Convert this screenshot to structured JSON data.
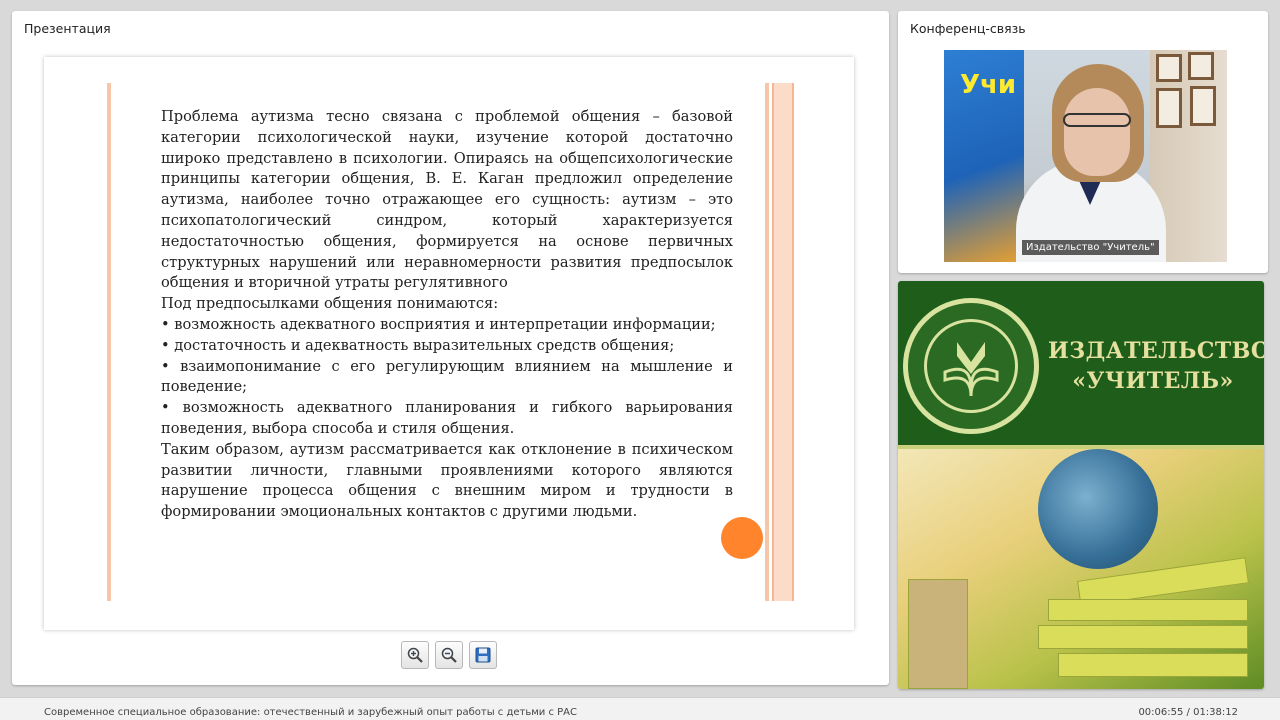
{
  "presentation": {
    "title": "Презентация",
    "slide": {
      "paragraphs": [
        "Проблема аутизма тесно связана с проблемой общения – базовой категории психологической науки, изучение которой достаточно широко представлено в психологии. Опираясь на общепсихологические принципы категории общения, В. Е. Каган предложил определение аутизма, наиболее точно отражающее его сущность: аутизм – это психопатологический синдром, который характеризуется недостаточностью общения, формируется на основе первичных структурных нарушений или неравномерности развития предпосылок общения и вторичной утраты регулятивного",
        "Под предпосылками общения понимаются:",
        "• возможность адекватного восприятия и интерпретации информации;",
        "• достаточность и адекватность выразительных средств общения;",
        "• взаимопонимание с его регулирующим влиянием на мышление и поведение;",
        "• возможность адекватного планирования и гибкого варьирования поведения, выбора способа и стиля общения.",
        "Таким образом, аутизм рассматривается как отклонение в психическом развитии личности, главными проявлениями которого являются нарушение процесса общения с внешним миром и трудности в формировании эмоциональных контактов с другими людьми."
      ]
    },
    "toolbar": {
      "zoom_in_icon": "zoom-in-icon",
      "zoom_out_icon": "zoom-out-icon",
      "save_icon": "save-icon"
    }
  },
  "conference": {
    "title": "Конференц-связь",
    "video_label": "Издательство \"Учитель\"",
    "banner_text": "Учи"
  },
  "publisher": {
    "name_line1": "ИЗДАТЕЛЬСТВО",
    "name_line2": "«УЧИТЕЛЬ»"
  },
  "footer": {
    "course_title": "Современное специальное образование: отечественный и зарубежный опыт работы с детьми с РАС",
    "time": "00:06:55 / 01:38:12"
  },
  "colors": {
    "accent_orange": "#ff7a1a",
    "publisher_green": "#1e5e1a",
    "slide_decor": "#f7c6a9"
  }
}
